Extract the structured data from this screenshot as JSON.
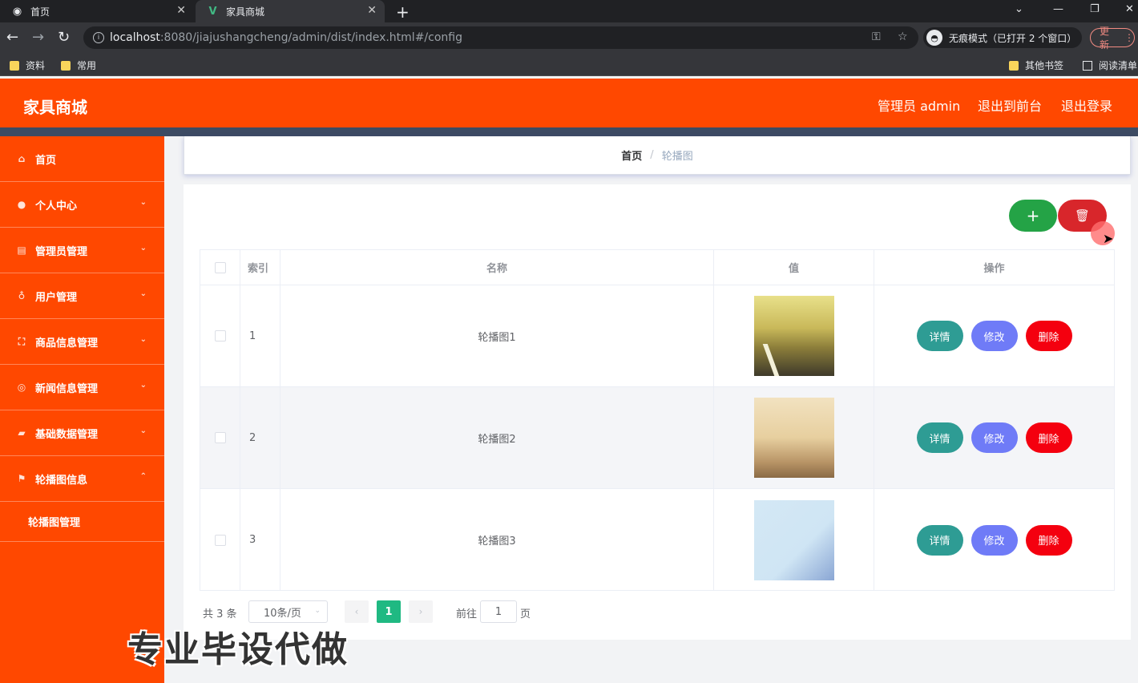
{
  "browser": {
    "tabs": [
      {
        "title": "首页",
        "icon": "globe-icon"
      },
      {
        "title": "家具商城",
        "icon": "vue-icon"
      }
    ],
    "url_host": "localhost",
    "url_rest": ":8080/jiajushangcheng/admin/dist/index.html#/config",
    "incognito_label": "无痕模式（已打开 2 个窗口）",
    "update_label": "更新",
    "bookmarks": [
      "资料",
      "常用"
    ],
    "bookmarks_right": [
      "其他书签",
      "阅读清单"
    ]
  },
  "header": {
    "brand": "家具商城",
    "links": [
      "管理员 admin",
      "退出到前台",
      "退出登录"
    ]
  },
  "sidebar": {
    "items": [
      {
        "label": "首页",
        "icon": "home-icon"
      },
      {
        "label": "个人中心",
        "icon": "user-icon"
      },
      {
        "label": "管理员管理",
        "icon": "clipboard-icon"
      },
      {
        "label": "用户管理",
        "icon": "microphone-icon"
      },
      {
        "label": "商品信息管理",
        "icon": "fullscreen-icon"
      },
      {
        "label": "新闻信息管理",
        "icon": "target-icon"
      },
      {
        "label": "基础数据管理",
        "icon": "wallet-icon"
      },
      {
        "label": "轮播图信息",
        "icon": "flag-icon"
      }
    ],
    "submenu": "轮播图管理"
  },
  "breadcrumb": {
    "home": "首页",
    "separator": "/",
    "current": "轮播图"
  },
  "toolbar": {
    "add_symbol": "+",
    "delete_symbol": "🗑"
  },
  "table": {
    "headers": [
      "索引",
      "名称",
      "值",
      "操作"
    ],
    "rows": [
      {
        "index": "1",
        "name": "轮播图1"
      },
      {
        "index": "2",
        "name": "轮播图2"
      },
      {
        "index": "3",
        "name": "轮播图3"
      }
    ],
    "actions": {
      "detail": "详情",
      "edit": "修改",
      "delete": "删除"
    }
  },
  "pagination": {
    "total": "共 3 条",
    "page_size": "10条/页",
    "current_page": "1",
    "goto_label": "前往",
    "goto_value": "1",
    "page_suffix": "页"
  },
  "watermark": "专业毕设代做",
  "colors": {
    "accent": "#ff4800",
    "success": "#24a346",
    "danger": "#d8262b",
    "pager_active": "#1fb982"
  }
}
